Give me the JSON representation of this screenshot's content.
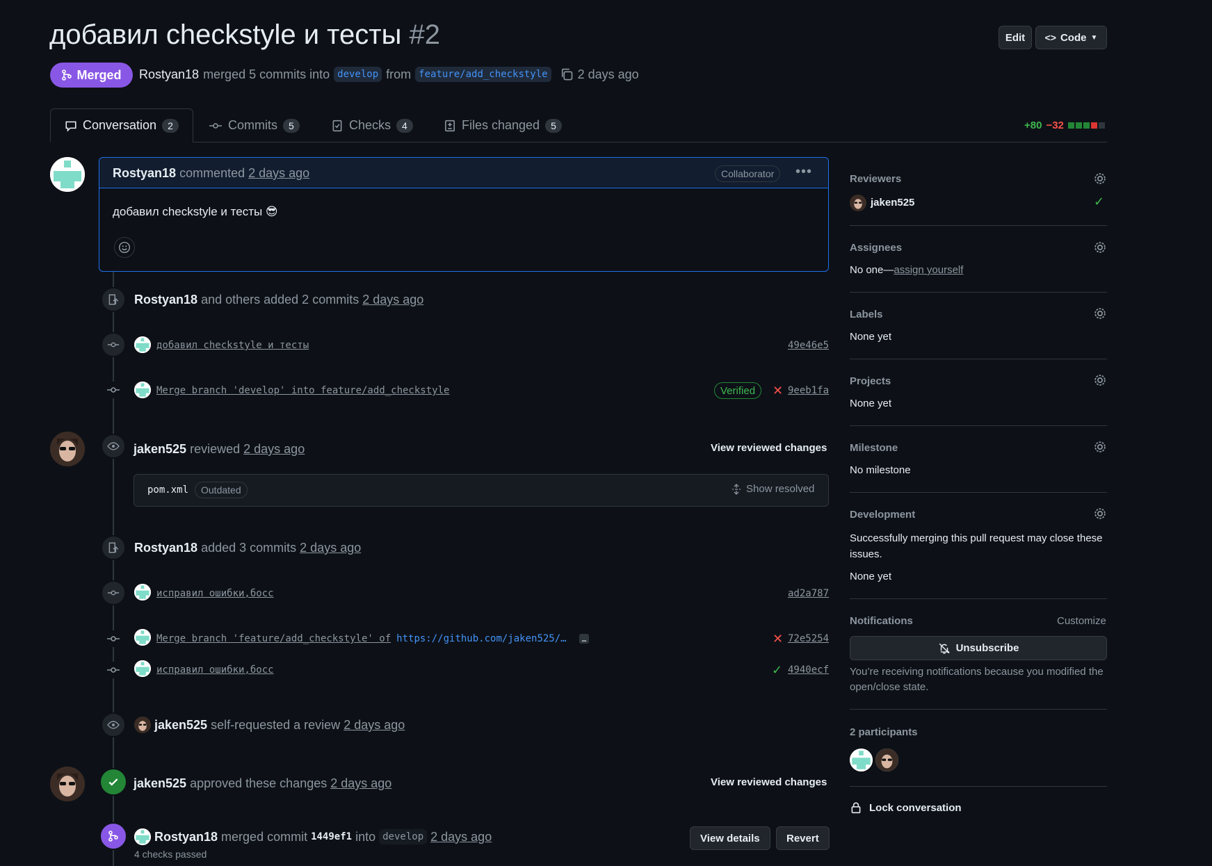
{
  "header": {
    "title": "добавил checkstyle и тесты",
    "number": "#2",
    "edit_label": "Edit",
    "code_label": "Code",
    "state_label": "Merged",
    "author": "Rostyan18",
    "merged_text": "merged 5 commits into",
    "base_branch": "develop",
    "from_text": "from",
    "head_branch": "feature/add_checkstyle",
    "time": "2 days ago"
  },
  "tabs": [
    {
      "label": "Conversation",
      "count": "2",
      "icon": "comment-icon"
    },
    {
      "label": "Commits",
      "count": "5",
      "icon": "commit-icon"
    },
    {
      "label": "Checks",
      "count": "4",
      "icon": "checklist-icon"
    },
    {
      "label": "Files changed",
      "count": "5",
      "icon": "file-diff-icon"
    }
  ],
  "diffstat": {
    "additions": "+80",
    "deletions": "−32",
    "colors": [
      "#238636",
      "#238636",
      "#238636",
      "#da3633",
      "#30363d"
    ]
  },
  "comment": {
    "author": "Rostyan18",
    "action": "commented",
    "time": "2 days ago",
    "role": "Collaborator",
    "body": "добавил checkstyle и тесты 😎"
  },
  "timeline": {
    "event1": {
      "author": "Rostyan18",
      "text": "and others added 2 commits",
      "time": "2 days ago"
    },
    "commit1": {
      "message": "добавил checkstyle и тесты",
      "sha": "49e46e5"
    },
    "commit2": {
      "message": "Merge branch 'develop' into feature/add_checkstyle",
      "badge": "Verified",
      "sha": "9eeb1fa"
    },
    "review1": {
      "author": "jaken525",
      "text": "reviewed",
      "time": "2 days ago",
      "action": "View reviewed changes",
      "file": "pom.xml",
      "file_badge": "Outdated",
      "show_resolved": "Show resolved"
    },
    "event2": {
      "author": "Rostyan18",
      "text": "added 3 commits",
      "time": "2 days ago"
    },
    "commit3": {
      "message": "исправил ошибки,босс",
      "sha": "ad2a787"
    },
    "commit4": {
      "message": "Merge branch 'feature/add_checkstyle' of",
      "url": "https://github.com/jaken525/…",
      "more": "…",
      "sha": "72e5254"
    },
    "commit5": {
      "message": "исправил ошибки,босс",
      "sha": "4940ecf"
    },
    "event3": {
      "author": "jaken525",
      "text": "self-requested a review",
      "time": "2 days ago"
    },
    "review2": {
      "author": "jaken525",
      "text": "approved these changes",
      "time": "2 days ago",
      "action": "View reviewed changes"
    },
    "merge": {
      "author": "Rostyan18",
      "text": "merged commit",
      "sha": "1449ef1",
      "into": "into",
      "branch": "develop",
      "time": "2 days ago",
      "checks": "4 checks passed",
      "details_label": "View details",
      "revert_label": "Revert"
    }
  },
  "sidebar": {
    "reviewers": {
      "label": "Reviewers",
      "name": "jaken525"
    },
    "assignees": {
      "label": "Assignees",
      "value": "No one—",
      "link": "assign yourself"
    },
    "labels": {
      "label": "Labels",
      "value": "None yet"
    },
    "projects": {
      "label": "Projects",
      "value": "None yet"
    },
    "milestone": {
      "label": "Milestone",
      "value": "No milestone"
    },
    "development": {
      "label": "Development",
      "desc": "Successfully merging this pull request may close these issues.",
      "value": "None yet"
    },
    "notifications": {
      "label": "Notifications",
      "customize": "Customize",
      "button": "Unsubscribe",
      "reason": "You’re receiving notifications because you modified the open/close state."
    },
    "participants": {
      "label": "2 participants"
    },
    "lock": {
      "label": "Lock conversation"
    }
  }
}
